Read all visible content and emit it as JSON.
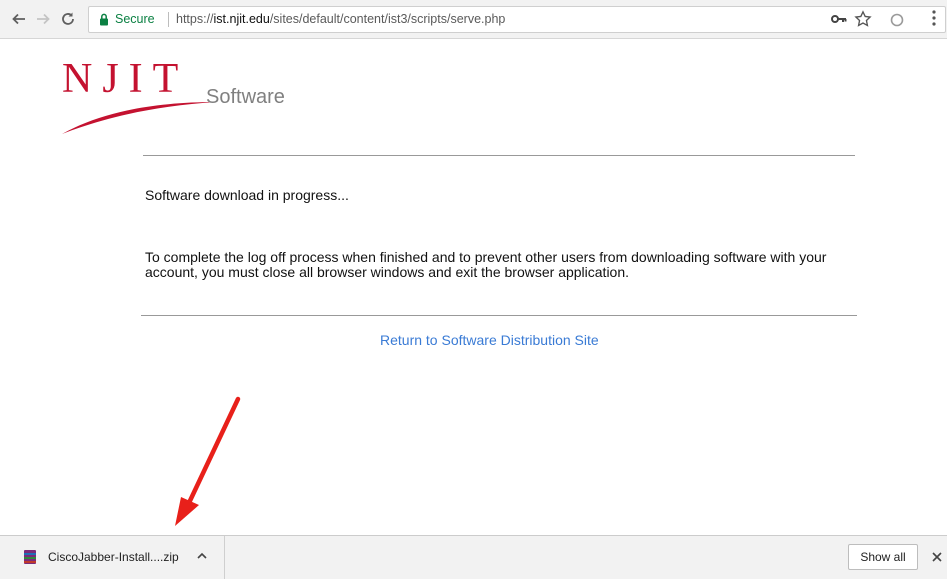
{
  "browser": {
    "back_icon": "arrow-left-icon",
    "forward_icon": "arrow-right-icon",
    "reload_icon": "reload-icon",
    "secure_label": "Secure",
    "url_scheme": "https://",
    "url_host": "ist.njit.edu",
    "url_path": "/sites/default/content/ist3/scripts/serve.php",
    "secure_color": "#0b8043"
  },
  "page": {
    "logo_text": "NJIT",
    "title": "Software",
    "status": "Software download in progress...",
    "notice": "To complete the log off process when finished and to prevent other users from downloading software with your account, you must close all browser windows and exit the browser application.",
    "return_link": "Return to Software Distribution Site",
    "brand_color": "#c41230",
    "link_color": "#3a7bd5"
  },
  "download_shelf": {
    "file_name": "CiscoJabber-Install....zip",
    "show_all_label": "Show all",
    "annotation_arrow_color": "#e8201a"
  }
}
